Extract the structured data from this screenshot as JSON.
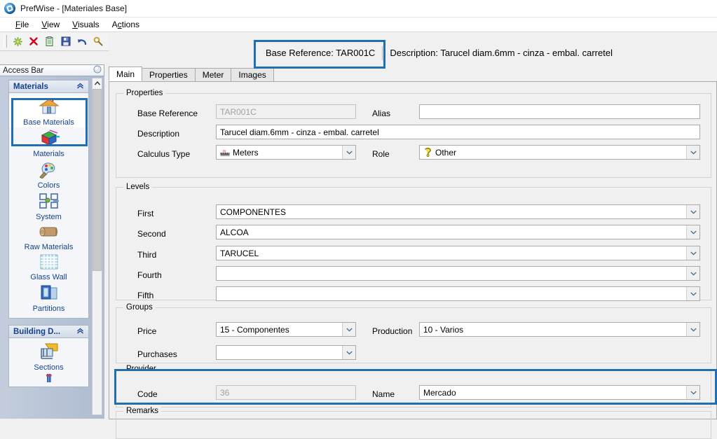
{
  "window": {
    "title": "PrefWise - [Materiales Base]",
    "app_icon": "app-globe-icon"
  },
  "menubar": [
    {
      "label": "File"
    },
    {
      "label": "View"
    },
    {
      "label": "Visuals"
    },
    {
      "label": "Actions"
    }
  ],
  "toolbar": {
    "buttons": [
      {
        "name": "new-icon",
        "glyph": "✳"
      },
      {
        "name": "delete-icon",
        "glyph": "✕"
      },
      {
        "name": "copy-icon",
        "glyph": "⎘"
      },
      {
        "name": "save-icon",
        "glyph": "ὋE"
      },
      {
        "name": "undo-icon",
        "glyph": "↶"
      },
      {
        "name": "find-icon",
        "glyph": "⚲"
      },
      {
        "name": "stop-icon",
        "glyph": "0"
      },
      {
        "name": "refresh-half-icon",
        "glyph": "◔"
      },
      {
        "name": "refresh-icon",
        "glyph": "↻"
      },
      {
        "name": "report-icon",
        "glyph": "▤"
      },
      {
        "name": "preview-icon",
        "glyph": "▣"
      },
      {
        "name": "print-icon",
        "glyph": "⎙"
      },
      {
        "name": "list-icon",
        "glyph": "≡"
      }
    ]
  },
  "header": {
    "reference_label": "Base Reference: TAR001C",
    "description_label": "Description: Tarucel diam.6mm - cinza - embal. carretel"
  },
  "access_bar": {
    "title": "Access Bar",
    "groups": [
      {
        "title": "Materials",
        "collapse_glyph": "«",
        "items": [
          {
            "label": "Base Materials",
            "icon": "house-icon",
            "selected": true
          },
          {
            "label": "Materials",
            "icon": "cube-icon",
            "selected": false
          },
          {
            "label": "Colors",
            "icon": "palette-icon",
            "selected": false
          },
          {
            "label": "System",
            "icon": "frame-system-icon",
            "selected": false
          },
          {
            "label": "Raw Materials",
            "icon": "log-icon",
            "selected": false
          },
          {
            "label": "Glass Wall",
            "icon": "grid-glass-icon",
            "selected": false
          },
          {
            "label": "Partitions",
            "icon": "partition-icon",
            "selected": false
          }
        ]
      },
      {
        "title": "Building D...",
        "collapse_glyph": "«",
        "items": [
          {
            "label": "Sections",
            "icon": "sections-icon",
            "selected": false
          }
        ]
      }
    ]
  },
  "tabs": [
    {
      "label": "Main",
      "active": true
    },
    {
      "label": "Properties",
      "active": false
    },
    {
      "label": "Meter",
      "active": false
    },
    {
      "label": "Images",
      "active": false
    }
  ],
  "form": {
    "properties": {
      "caption": "Properties",
      "base_reference": {
        "label": "Base Reference",
        "value": "TAR001C",
        "readonly": true
      },
      "alias": {
        "label": "Alias",
        "value": "",
        "readonly": false
      },
      "description": {
        "label": "Description",
        "value": "Tarucel diam.6mm - cinza - embal. carretel"
      },
      "calculus_type": {
        "label": "Calculus Type",
        "value": "Meters",
        "icon": "meters-icon"
      },
      "role": {
        "label": "Role",
        "value": "Other",
        "icon": "question-mark-icon"
      }
    },
    "levels": {
      "caption": "Levels",
      "fields": [
        {
          "label": "First",
          "value": "COMPONENTES"
        },
        {
          "label": "Second",
          "value": "ALCOA"
        },
        {
          "label": "Third",
          "value": "TARUCEL"
        },
        {
          "label": "Fourth",
          "value": ""
        },
        {
          "label": "Fifth",
          "value": ""
        }
      ]
    },
    "groups": {
      "caption": "Groups",
      "price": {
        "label": "Price",
        "value": "15 - Componentes"
      },
      "production": {
        "label": "Production",
        "value": "10 - Varios"
      },
      "purchases": {
        "label": "Purchases",
        "value": ""
      }
    },
    "provider": {
      "caption": "Provider",
      "code": {
        "label": "Code",
        "value": "36",
        "readonly": true
      },
      "name": {
        "label": "Name",
        "value": "Mercado"
      }
    },
    "remarks": {
      "caption": "Remarks"
    }
  },
  "highlights": {
    "accent_color": "#1f6fb2"
  }
}
